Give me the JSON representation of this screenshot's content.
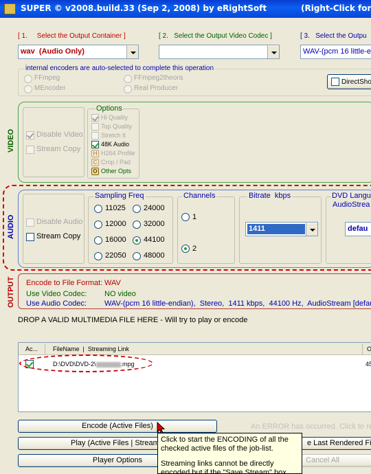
{
  "title": {
    "left": "SUPER © v2008.build.33 (Sep 2, 2008) by eRightSoft",
    "right": "(Right-Click for"
  },
  "steps": {
    "s1": "[ 1.     Select the Output Container ]",
    "s2": "[ 2.   Select the Output Video Codec ]",
    "s3": "[ 3.   Select the Outpu"
  },
  "combos": {
    "container": "wav  (Audio Only)",
    "video_codec": "",
    "audio_codec": "WAV-(pcm 16 little-e"
  },
  "encoders": {
    "legend": "internal encoders are auto-selected to complete this operation",
    "ffmpeg": "FFmpeg",
    "ffmpeg2theora": "FFmpeg2theora",
    "mencoder": "MEncoder",
    "realproducer": "Real Producer",
    "direct_show": "DirectSho"
  },
  "video": {
    "label": "VIDEO",
    "disable_video": "Disable Video",
    "stream_copy": "Stream Copy",
    "options_title": "Options",
    "options": {
      "hi_quality": "Hi Quality",
      "top_quality": "Top Quality",
      "stretch_it": "Stretch It",
      "k48_audio": "48K Audio",
      "h264_profile": "H264 Profile",
      "crop_pad": "Crop / Pad",
      "other_opts": "Other Opts"
    },
    "opt_badges": {
      "h": "H",
      "c": "C",
      "o": "O"
    }
  },
  "audio": {
    "label": "AUDIO",
    "disable_audio": "Disable Audio",
    "stream_copy": "Stream Copy",
    "sampling_title": "Sampling Freq",
    "freqs": [
      "11025",
      "24000",
      "12000",
      "32000",
      "16000",
      "44100",
      "22050",
      "48000"
    ],
    "channels_title": "Channels",
    "ch1": "1",
    "ch2": "2",
    "bitrate_title": "Bitrate  kbps",
    "bitrate_value": "1411",
    "dvd_title1": "DVD Langu",
    "dvd_title2": "AudioStrea",
    "dvd_value": "defau"
  },
  "output": {
    "label": "OUTPUT",
    "rows": [
      {
        "key": "Encode to File Format:",
        "val": "WAV"
      },
      {
        "key": "Use Video Codec:",
        "val": "NO video"
      },
      {
        "key": "Use Audio Codec:",
        "val": "WAV-(pcm 16 little-endian),  Stereo,  1411 kbps,  44100 Hz,  AudioStream [defau"
      }
    ]
  },
  "drop_hint": "DROP A VALID MULTIMEDIA FILE HERE - Will try to play or encode",
  "list": {
    "col_active": "Ac...",
    "col_file": "FileName  |  Streaming Link",
    "col_o": "O",
    "row_file_prefix": "D:\\DVD\\DVD-2\\",
    "row_file_suffix": ".mpg",
    "row_o": "45"
  },
  "buttons": {
    "encode": "Encode (Active Files)",
    "error_msg": "An ERROR has occurred. Click to re",
    "play": "Play (Active Files | Streams",
    "last_rendered": "e Last Rendered File",
    "player_options": "Player Options",
    "cancel_all": "Cancel All"
  },
  "tooltip": {
    "line1": "Click to start the ENCODING of all the",
    "line2": "checked active files of the job-list.",
    "line3": "Streaming links cannot be directly",
    "line4": "encoded but if the \"Save Stream\" box"
  },
  "colors": {
    "title_blue": "#0a54e6",
    "step_red": "#b00000",
    "video_green": "#006000",
    "audio_blue": "#0000b0",
    "annotation_red": "#d00000",
    "tooltip_bg": "#ffffe1"
  }
}
